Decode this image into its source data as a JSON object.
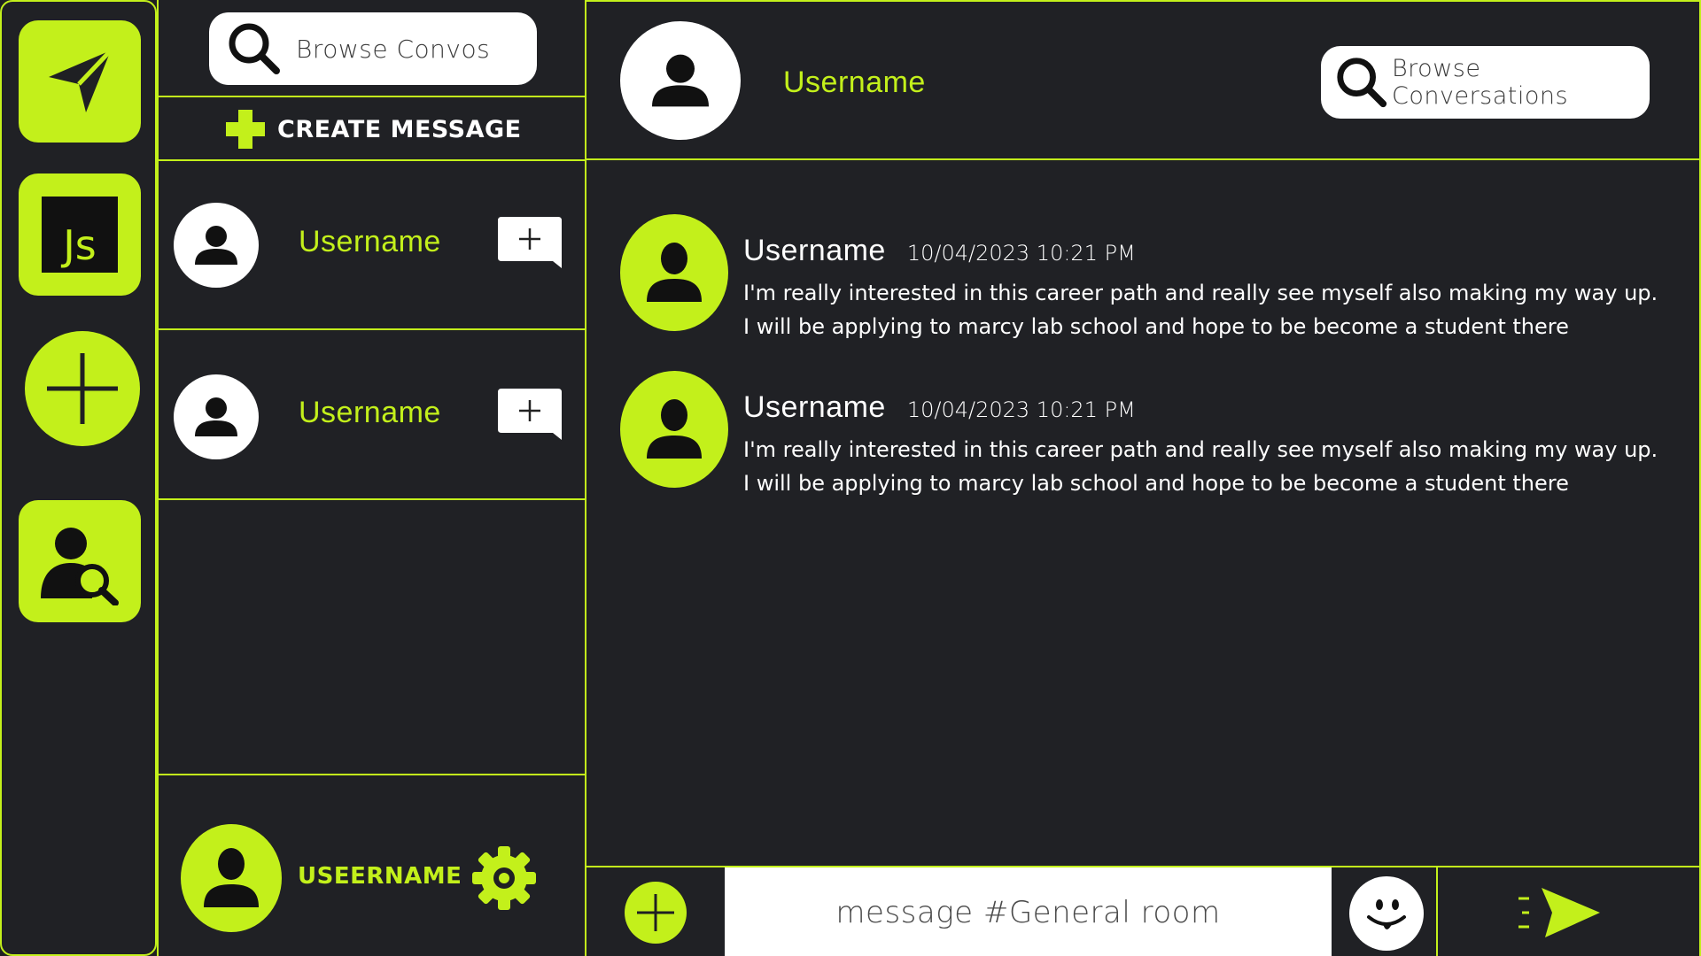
{
  "colors": {
    "accent": "#c3f01b",
    "background": "#1f2023",
    "surface": "#ffffff"
  },
  "rail": {
    "items": [
      {
        "icon": "paper-plane-icon"
      },
      {
        "icon": "javascript-icon",
        "label": "Js"
      },
      {
        "icon": "plus-icon"
      },
      {
        "icon": "user-search-icon"
      }
    ]
  },
  "conversations": {
    "search_placeholder": "Browse Convos",
    "create_label": "CREATE MESSAGE",
    "items": [
      {
        "name": "Username"
      },
      {
        "name": "Username"
      }
    ]
  },
  "current_user": {
    "name": "USEERNAME"
  },
  "chat": {
    "header_name": "Username",
    "search_placeholder": "Browse Conversations",
    "messages": [
      {
        "user": "Username",
        "time": "10/04/2023 10:21 PM",
        "lines": [
          "I'm really interested in this career path and really see myself also making my way up.",
          "I will be applying to marcy lab school and hope to be become a student there"
        ]
      },
      {
        "user": "Username",
        "time": "10/04/2023 10:21 PM",
        "lines": [
          "I'm really interested in this career path and really see myself also making my way up.",
          "I will be applying to marcy lab school and hope to be become a student there"
        ]
      }
    ],
    "composer_placeholder": "message #General room"
  }
}
